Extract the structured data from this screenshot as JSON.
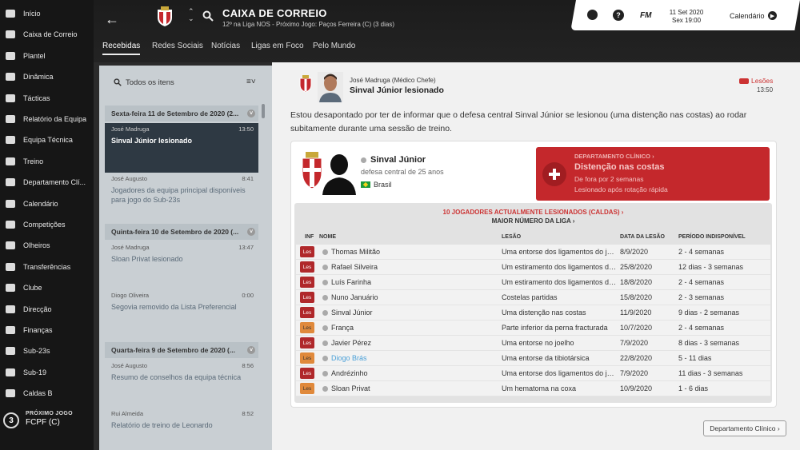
{
  "sidebar": {
    "items": [
      {
        "label": "Início",
        "icon": "home-icon"
      },
      {
        "label": "Caixa de Correio",
        "icon": "mail-icon"
      },
      {
        "label": "Plantel",
        "icon": "squad-icon"
      },
      {
        "label": "Dinâmica",
        "icon": "dynamics-icon"
      },
      {
        "label": "Tácticas",
        "icon": "tactics-icon"
      },
      {
        "label": "Relatório da Equipa",
        "icon": "report-icon"
      },
      {
        "label": "Equipa Técnica",
        "icon": "staff-icon"
      },
      {
        "label": "Treino",
        "icon": "training-icon"
      },
      {
        "label": "Departamento Clí...",
        "icon": "medical-icon"
      },
      {
        "label": "Calendário",
        "icon": "calendar-icon"
      },
      {
        "label": "Competições",
        "icon": "trophy-icon"
      },
      {
        "label": "Olheiros",
        "icon": "scouting-icon"
      },
      {
        "label": "Transferências",
        "icon": "transfer-icon"
      },
      {
        "label": "Clube",
        "icon": "club-icon"
      },
      {
        "label": "Direcção",
        "icon": "board-icon"
      },
      {
        "label": "Finanças",
        "icon": "finance-icon"
      },
      {
        "label": "Sub-23s",
        "icon": "u23-icon"
      },
      {
        "label": "Sub-19",
        "icon": "u19-icon"
      },
      {
        "label": "Caldas B",
        "icon": "reserve-icon"
      }
    ],
    "next_match": {
      "title": "PRÓXIMO JOGO",
      "number": "3",
      "team": "FCPF (C)"
    }
  },
  "header": {
    "title": "CAIXA DE CORREIO",
    "subtitle": "12º na Liga NOS - Próximo Jogo: Paços Ferreira (C) (3 dias)",
    "tabs": [
      "Recebidas",
      "Redes Sociais",
      "Notícias",
      "Ligas em Foco",
      "Pelo Mundo"
    ],
    "fm_label": "FM",
    "date_line1": "11 Set 2020",
    "date_line2": "Sex 19:00",
    "calendar_label": "Calendário",
    "help_label": "?"
  },
  "inbox": {
    "filter_label": "Todos os itens",
    "days": [
      {
        "header": "Sexta-feira 11 de Setembro de 2020 (2...",
        "messages": [
          {
            "from": "José Madruga",
            "time": "13:50",
            "subject": "Sinval Júnior lesionado"
          },
          {
            "from": "José Augusto",
            "time": "8:41",
            "subject": "Jogadores da equipa principal disponíveis para jogo do Sub-23s"
          }
        ]
      },
      {
        "header": "Quinta-feira 10 de Setembro de 2020 (...",
        "messages": [
          {
            "from": "José Madruga",
            "time": "13:47",
            "subject": "Sloan Privat lesionado"
          },
          {
            "from": "Diogo Oliveira",
            "time": "0:00",
            "subject": "Segovia removido da Lista Preferencial"
          }
        ]
      },
      {
        "header": "Quarta-feira 9 de Setembro de 2020 (...",
        "messages": [
          {
            "from": "José Augusto",
            "time": "8:56",
            "subject": "Resumo de conselhos da equipa técnica"
          },
          {
            "from": "Rui Almeida",
            "time": "8:52",
            "subject": "Relatório de treino de Leonardo"
          }
        ]
      }
    ]
  },
  "message": {
    "sender": "José Madruga  (Médico Chefe)",
    "title": "Sinval Júnior lesionado",
    "tag": "Lesões",
    "time": "13:50",
    "body": "Estou desapontado por ter de informar que o defesa central Sinval Júnior se lesionou (uma distenção nas costas) ao rodar subitamente durante uma sessão de treino.",
    "player": {
      "name": "Sinval Júnior",
      "position": "defesa central de 25 anos",
      "nationality": "Brasil"
    },
    "medical": {
      "link": "DEPARTAMENTO CLÍNICO ›",
      "injury": "Distenção nas costas",
      "duration": "De fora por 2 semanas",
      "note": "Lesionado após rotação rápida"
    },
    "table": {
      "title": "10 JOGADORES ACTUALMENTE LESIONADOS (CALDAS) ›",
      "subtitle": "MAIOR NÚMERO DA LIGA ›",
      "headers": {
        "inf": "INF",
        "name": "NOME",
        "injury": "LESÃO",
        "date": "DATA DA LESÃO",
        "period": "PERÍODO INDISPONÍVEL"
      },
      "rows": [
        {
          "badge": "Les",
          "severity": "red",
          "name": "Thomas Militão",
          "injury": "Uma entorse dos ligamentos do joelho",
          "date": "8/9/2020",
          "period": "2 - 4 semanas"
        },
        {
          "badge": "Les",
          "severity": "red",
          "name": "Rafael Silveira",
          "injury": "Um estiramento dos ligamentos do tornozelo",
          "date": "25/8/2020",
          "period": "12 dias - 3 semanas"
        },
        {
          "badge": "Les",
          "severity": "red",
          "name": "Luís Farinha",
          "injury": "Um estiramento dos ligamentos do tornozelo",
          "date": "18/8/2020",
          "period": "2 - 4 semanas"
        },
        {
          "badge": "Les",
          "severity": "red",
          "name": "Nuno Januário",
          "injury": "Costelas partidas",
          "date": "15/8/2020",
          "period": "2 - 3 semanas"
        },
        {
          "badge": "Les",
          "severity": "red",
          "name": "Sinval Júnior",
          "injury": "Uma distenção nas costas",
          "date": "11/9/2020",
          "period": "9 dias - 2 semanas"
        },
        {
          "badge": "Les",
          "severity": "orange",
          "name": "França",
          "injury": "Parte inferior da perna fracturada",
          "date": "10/7/2020",
          "period": "2 - 4 semanas"
        },
        {
          "badge": "Les",
          "severity": "red",
          "name": "Javier Pérez",
          "injury": "Uma entorse no joelho",
          "date": "7/9/2020",
          "period": "8 dias - 3 semanas"
        },
        {
          "badge": "Les",
          "severity": "orange",
          "name": "Diogo Brás",
          "injury": "Uma entorse da tibiotársica",
          "date": "22/8/2020",
          "period": "5 - 11 dias"
        },
        {
          "badge": "Les",
          "severity": "red",
          "name": "Andrézinho",
          "injury": "Uma entorse dos ligamentos do joelho",
          "date": "7/9/2020",
          "period": "11 dias - 3 semanas"
        },
        {
          "badge": "Les",
          "severity": "orange",
          "name": "Sloan Privat",
          "injury": "Um hematoma na coxa",
          "date": "10/9/2020",
          "period": "1 - 6 dias"
        }
      ]
    },
    "footer_button": "Departamento Clínico"
  },
  "colors": {
    "accent_red": "#c4282c",
    "sidebar_bg": "#161616",
    "selected_msg": "#2e3943"
  }
}
